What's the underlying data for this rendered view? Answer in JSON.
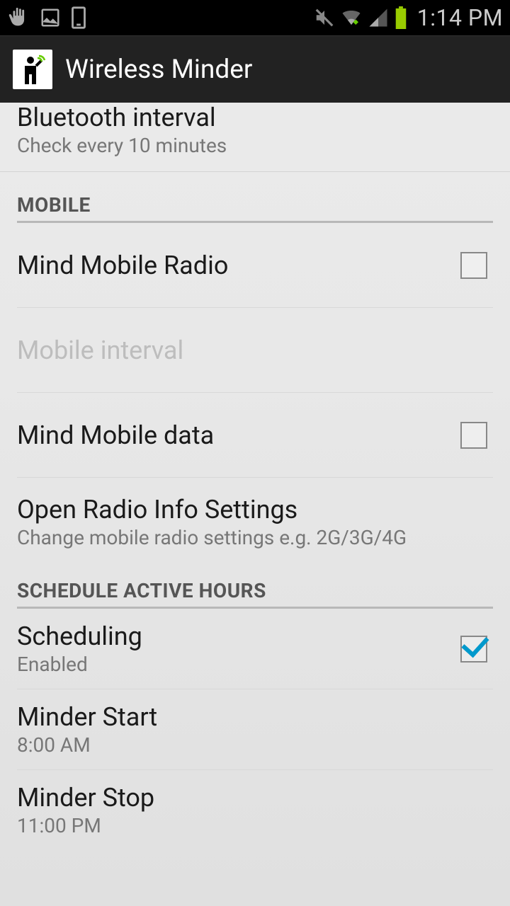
{
  "status": {
    "time": "1:14 PM"
  },
  "appbar": {
    "title": "Wireless Minder"
  },
  "partial_item": {
    "title": "Bluetooth interval",
    "sub": "Check every 10 minutes"
  },
  "section_mobile": {
    "header": "MOBILE",
    "items": [
      {
        "title": "Mind Mobile Radio",
        "type": "checkbox",
        "checked": false,
        "disabled": false
      },
      {
        "title": "Mobile interval",
        "type": "plain",
        "disabled": true
      },
      {
        "title": "Mind Mobile data",
        "type": "checkbox",
        "checked": false,
        "disabled": false
      },
      {
        "title": "Open Radio Info Settings",
        "sub": "Change mobile radio settings e.g. 2G/3G/4G",
        "type": "plain"
      }
    ]
  },
  "section_schedule": {
    "header": "SCHEDULE ACTIVE HOURS",
    "items": [
      {
        "title": "Scheduling",
        "sub": "Enabled",
        "type": "checkbox",
        "checked": true
      },
      {
        "title": "Minder Start",
        "sub": "8:00 AM",
        "type": "plain"
      },
      {
        "title": "Minder Stop",
        "sub": "11:00 PM",
        "type": "plain"
      }
    ]
  }
}
